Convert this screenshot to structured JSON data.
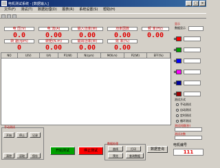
{
  "window": {
    "title": "电机测试系统 - [数据输入]"
  },
  "menu": [
    "文件(F)",
    "测试(T)",
    "数据处理(D)",
    "报表(R)",
    "系统设置(S)",
    "帮助(H)"
  ],
  "meters_top": [
    {
      "label": "电 压(V)",
      "value": "0.0"
    },
    {
      "label": "电 流(A)",
      "value": "0.00"
    },
    {
      "label": "输入功率(W)",
      "value": "0.00"
    },
    {
      "label": "功率因数",
      "value": "0.00"
    },
    {
      "label": "频 率(Hz)",
      "value": "0.00"
    }
  ],
  "meters_bottom": [
    {
      "label": "转 速(rpm)",
      "value": "0"
    },
    {
      "label": "转矩(N.m)",
      "value": "0.00"
    },
    {
      "label": "输出功率(W)",
      "value": "0.00"
    },
    {
      "label": "效 率(%)",
      "value": "0.00"
    }
  ],
  "table": {
    "columns": [
      "NO",
      "U(V)",
      "I(A)",
      "P1(W)",
      "N(rpm)",
      "M(N.m)",
      "P2(W)",
      "EFF(%)"
    ]
  },
  "right_panel": {
    "group_label": "显示",
    "select_label": "数据显示",
    "channels": [
      {
        "color": "#ff0000",
        "value": ""
      },
      {
        "color": "#00a000",
        "value": ""
      },
      {
        "color": "#0000ff",
        "value": ""
      },
      {
        "color": "#ff00ff",
        "value": ""
      },
      {
        "color": "#0000a0",
        "value": ""
      },
      {
        "color": "#a00000",
        "value": ""
      }
    ],
    "mode_label": "测试方式",
    "modes": [
      "手动测试",
      "自动测试",
      "定时测试",
      "循环测试"
    ],
    "interval_label": "测试间隔(秒)",
    "count_label": "测试次数",
    "motor_label": "电机编号",
    "motor_value": "111"
  },
  "bottom": {
    "manual_group": "手动测试",
    "btn_start_small": "开始",
    "btn_stop_small": "停止",
    "btn_record": "记录",
    "btn_clear": "清除",
    "btn_read": "读取",
    "btn_save": "保存",
    "btn_start_test": "开始测试",
    "btn_stop_test": "停止测试",
    "data_group": "数据处理",
    "btn_curve": "曲线",
    "btn_print": "打印",
    "btn_preview": "预览",
    "btn_query": "查询数据",
    "btn_data_query": "数据查询",
    "btn_reset": "复位"
  }
}
